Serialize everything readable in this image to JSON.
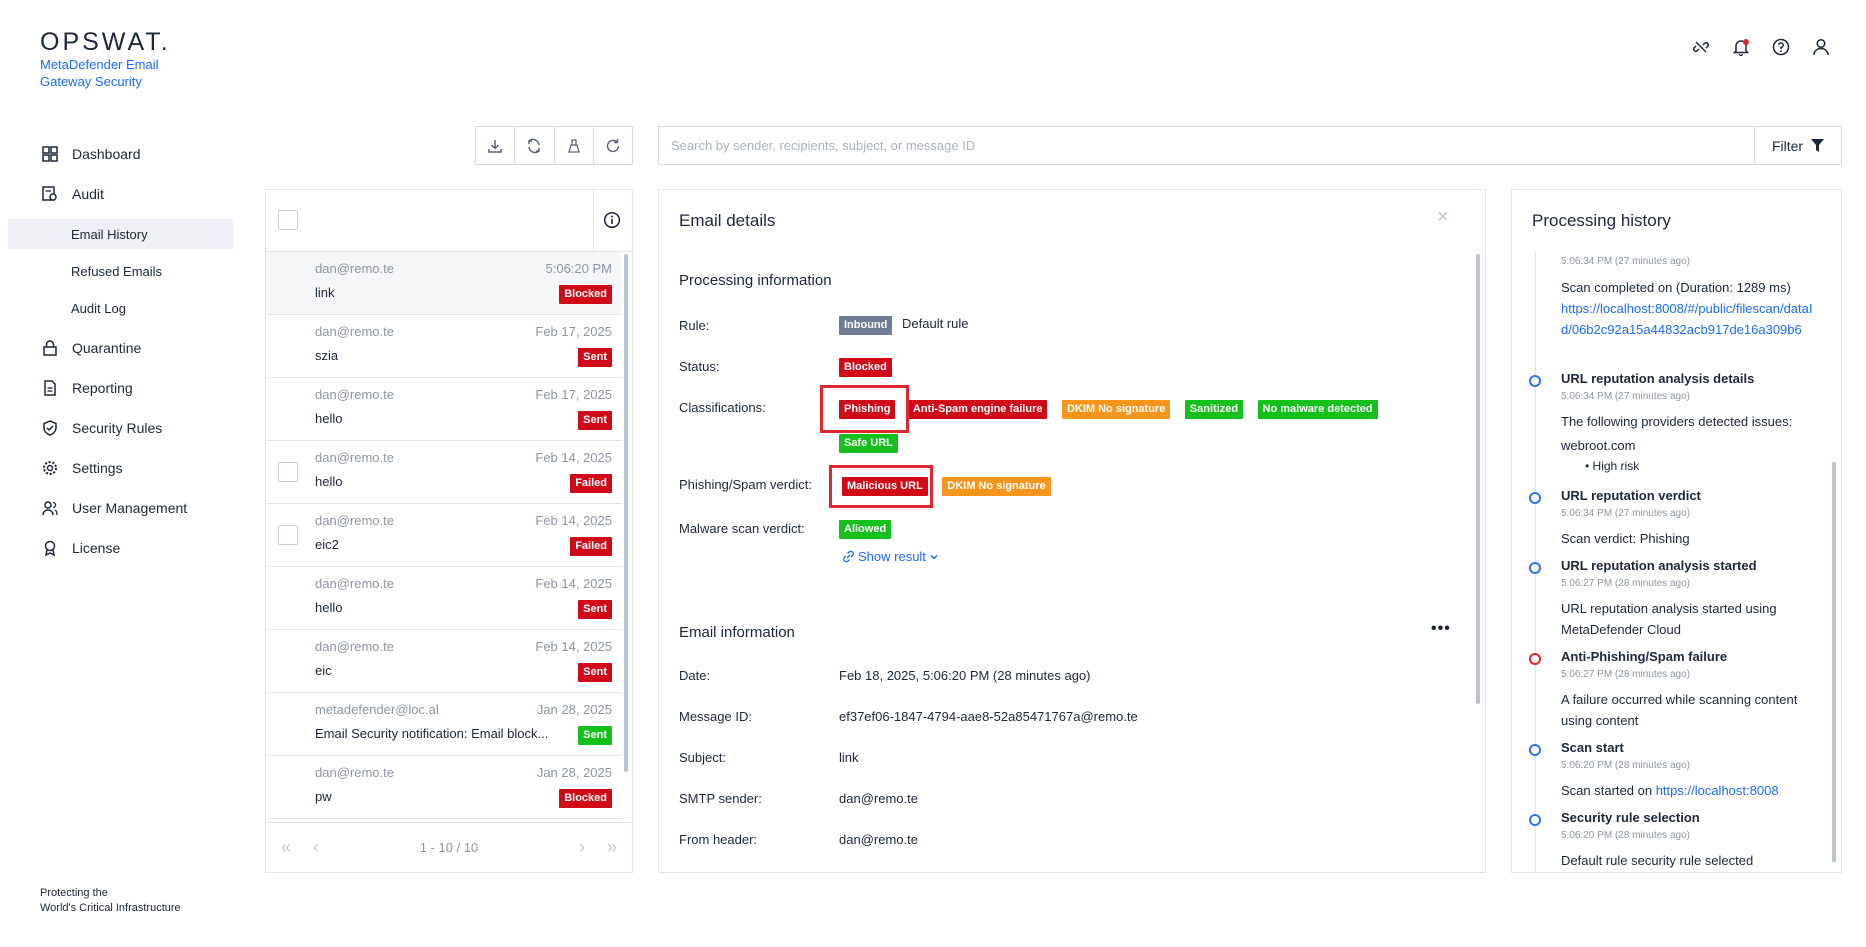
{
  "brand": {
    "logo": "OPSWAT.",
    "product": "MetaDefender Email Gateway Security",
    "footer_line1": "Protecting the",
    "footer_line2": "World's Critical Infrastructure"
  },
  "nav": {
    "dashboard": "Dashboard",
    "audit": "Audit",
    "email_history": "Email History",
    "refused_emails": "Refused Emails",
    "audit_log": "Audit Log",
    "quarantine": "Quarantine",
    "reporting": "Reporting",
    "security_rules": "Security Rules",
    "settings": "Settings",
    "user_management": "User Management",
    "license": "License"
  },
  "search": {
    "placeholder": "Search by sender, recipients, subject, or message ID",
    "filter_label": "Filter"
  },
  "email_list": {
    "rows": [
      {
        "from": "dan@remo.te",
        "date": "5:06:20 PM",
        "subject": "link",
        "status": "Blocked",
        "status_color": "#d00a19"
      },
      {
        "from": "dan@remo.te",
        "date": "Feb 17, 2025",
        "subject": "szia",
        "status": "Sent",
        "status_color": "#d00a19"
      },
      {
        "from": "dan@remo.te",
        "date": "Feb 17, 2025",
        "subject": "hello",
        "status": "Sent",
        "status_color": "#d00a19"
      },
      {
        "from": "dan@remo.te",
        "date": "Feb 14, 2025",
        "subject": "hello",
        "status": "Failed",
        "status_color": "#d00a19"
      },
      {
        "from": "dan@remo.te",
        "date": "Feb 14, 2025",
        "subject": "eic2",
        "status": "Failed",
        "status_color": "#d00a19"
      },
      {
        "from": "dan@remo.te",
        "date": "Feb 14, 2025",
        "subject": "hello",
        "status": "Sent",
        "status_color": "#d00a19"
      },
      {
        "from": "dan@remo.te",
        "date": "Feb 14, 2025",
        "subject": "eic",
        "status": "Sent",
        "status_color": "#d00a19"
      },
      {
        "from": "metadefender@loc.al",
        "date": "Jan 28, 2025",
        "subject": "Email Security notification: Email block...",
        "status": "Sent",
        "status_color": "#15c01c"
      },
      {
        "from": "dan@remo.te",
        "date": "Jan 28, 2025",
        "subject": "pw",
        "status": "Blocked",
        "status_color": "#d00a19"
      }
    ],
    "pagination": "1 - 10 / 10"
  },
  "details": {
    "title": "Email details",
    "processing": {
      "title": "Processing information",
      "rule_label": "Rule:",
      "rule_tag": "Inbound",
      "rule_value": "Default rule",
      "status_label": "Status:",
      "status_value": "Blocked",
      "classifications_label": "Classifications:",
      "classifications": [
        {
          "text": "Phishing",
          "color": "red"
        },
        {
          "text": "Anti-Spam engine failure",
          "color": "red"
        },
        {
          "text": "DKIM No signature",
          "color": "orange"
        },
        {
          "text": "Sanitized",
          "color": "green"
        },
        {
          "text": "No malware detected",
          "color": "green"
        },
        {
          "text": "Safe URL",
          "color": "green"
        }
      ],
      "verdict_label": "Phishing/Spam verdict:",
      "verdicts": [
        {
          "text": "Malicious URL",
          "color": "red"
        },
        {
          "text": "DKIM No signature",
          "color": "orange"
        }
      ],
      "malware_label": "Malware scan verdict:",
      "malware_value": "Allowed",
      "show_result": "Show result"
    },
    "email_info": {
      "title": "Email information",
      "date_label": "Date:",
      "date_value": "Feb 18, 2025, 5:06:20 PM (28 minutes ago)",
      "msgid_label": "Message ID:",
      "msgid_value": "ef37ef06-1847-4794-aae8-52a85471767a@remo.te",
      "subject_label": "Subject:",
      "subject_value": "link",
      "smtp_label": "SMTP sender:",
      "smtp_value": "dan@remo.te",
      "from_label": "From header:",
      "from_value": "dan@remo.te"
    }
  },
  "history": {
    "title": "Processing history",
    "top_ts": "5:06:34 PM (27 minutes ago)",
    "top_text": "Scan completed on (Duration: 1289 ms)",
    "top_link": "https://localhost:8008/#/public/filescan/dataId/06b2c92a15a44832acb917de16a309b6",
    "events": [
      {
        "title": "URL reputation analysis details",
        "ts": "5:06:34 PM (27 minutes ago)",
        "desc": "The following providers detected issues:",
        "provider": "webroot.com",
        "bullet": "High risk"
      },
      {
        "title": "URL reputation verdict",
        "ts": "5:06:34 PM (27 minutes ago)",
        "desc": "Scan verdict: Phishing"
      },
      {
        "title": "URL reputation analysis started",
        "ts": "5:06:27 PM (28 minutes ago)",
        "desc": "URL reputation analysis started using MetaDefender Cloud"
      },
      {
        "title": "Anti-Phishing/Spam failure",
        "ts": "5:06:27 PM (28 minutes ago)",
        "desc": "A failure occurred while scanning content using content"
      },
      {
        "title": "Scan start",
        "ts": "5:06:20 PM (28 minutes ago)",
        "desc": "Scan started on",
        "link": "https://localhost:8008"
      },
      {
        "title": "Security rule selection",
        "ts": "5:06:20 PM (28 minutes ago)",
        "desc": "Default rule security rule selected"
      }
    ]
  }
}
